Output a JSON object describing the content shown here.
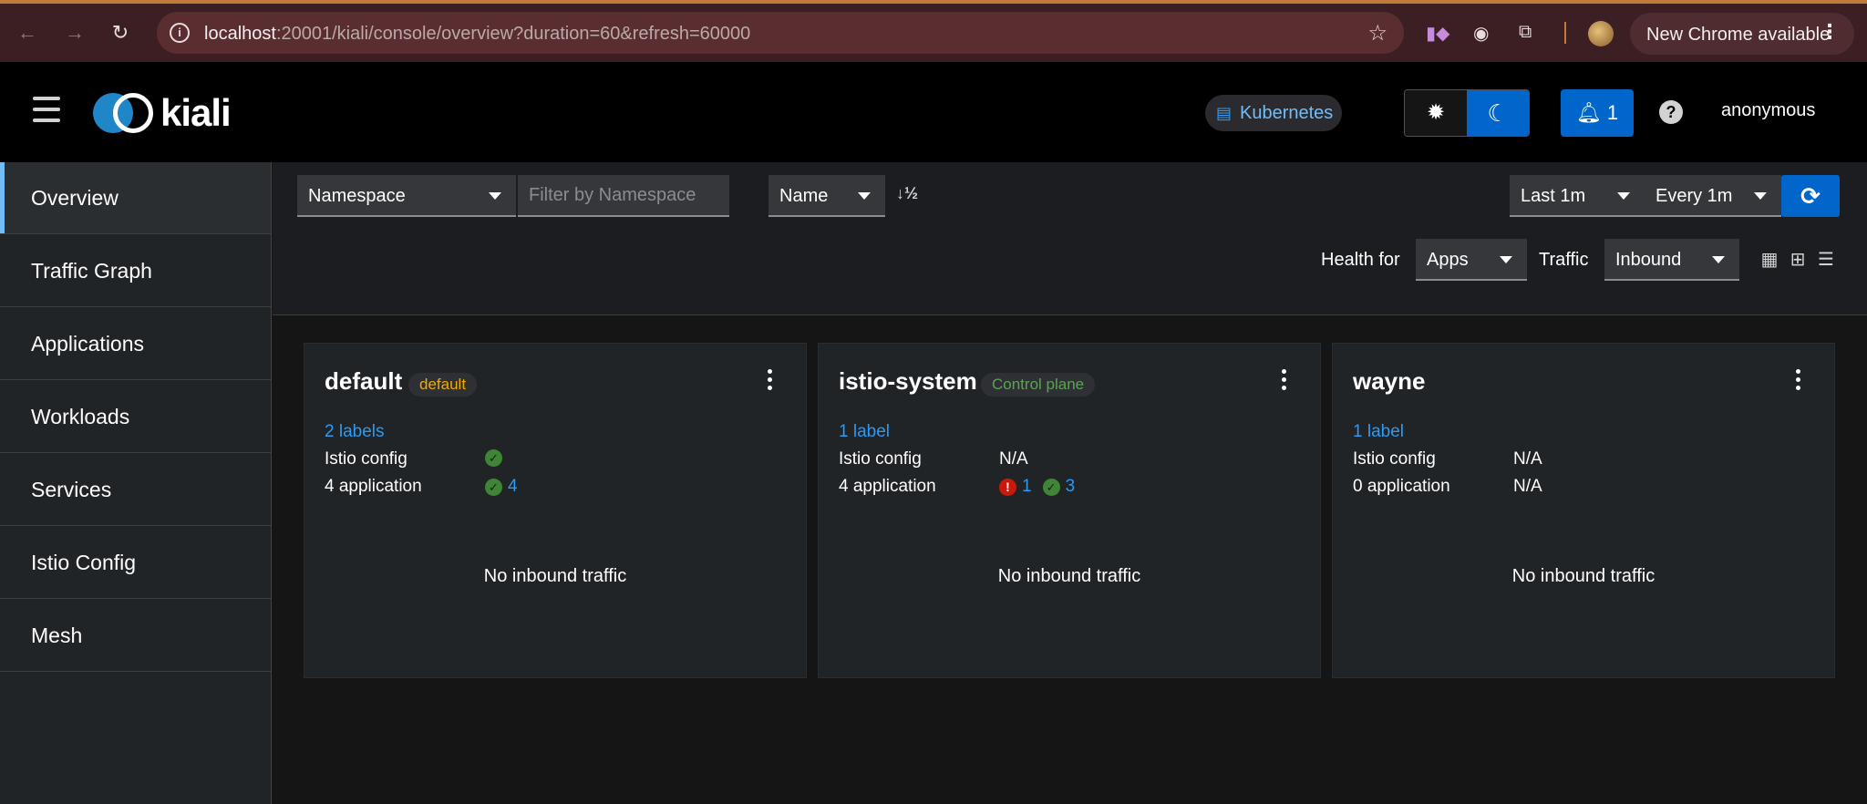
{
  "browser": {
    "url_host": "localhost",
    "url_rest": ":20001/kiali/console/overview?duration=60&refresh=60000",
    "update_label": "New Chrome available"
  },
  "header": {
    "logo_text": "kiali",
    "cluster": "Kubernetes",
    "notification_count": "1",
    "user": "anonymous"
  },
  "sidebar": {
    "items": [
      {
        "label": "Overview",
        "active": true
      },
      {
        "label": "Traffic Graph"
      },
      {
        "label": "Applications"
      },
      {
        "label": "Workloads"
      },
      {
        "label": "Services"
      },
      {
        "label": "Istio Config"
      },
      {
        "label": "Mesh"
      }
    ]
  },
  "toolbar": {
    "filter_type": "Namespace",
    "filter_placeholder": "Filter by Namespace",
    "sort_by": "Name",
    "duration": "Last 1m",
    "refresh": "Every 1m",
    "health_for_label": "Health for",
    "health_for_value": "Apps",
    "traffic_label": "Traffic",
    "traffic_value": "Inbound"
  },
  "cards": [
    {
      "name": "default",
      "badge": "default",
      "badge_color": "#f0ab00",
      "labels": "2 labels",
      "istio_config_label": "Istio config",
      "apps_label": "4 application",
      "apps_ok": "4",
      "traffic": "No inbound traffic"
    },
    {
      "name": "istio-system",
      "badge": "Control plane",
      "badge_color": "#5ba352",
      "labels": "1 label",
      "istio_config_label": "Istio config",
      "istio_config_value": "N/A",
      "apps_label": "4 application",
      "apps_err": "1",
      "apps_ok": "3",
      "traffic": "No inbound traffic"
    },
    {
      "name": "wayne",
      "labels": "1 label",
      "istio_config_label": "Istio config",
      "istio_config_value": "N/A",
      "apps_label": "0 application",
      "apps_value": "N/A",
      "traffic": "No inbound traffic"
    }
  ]
}
